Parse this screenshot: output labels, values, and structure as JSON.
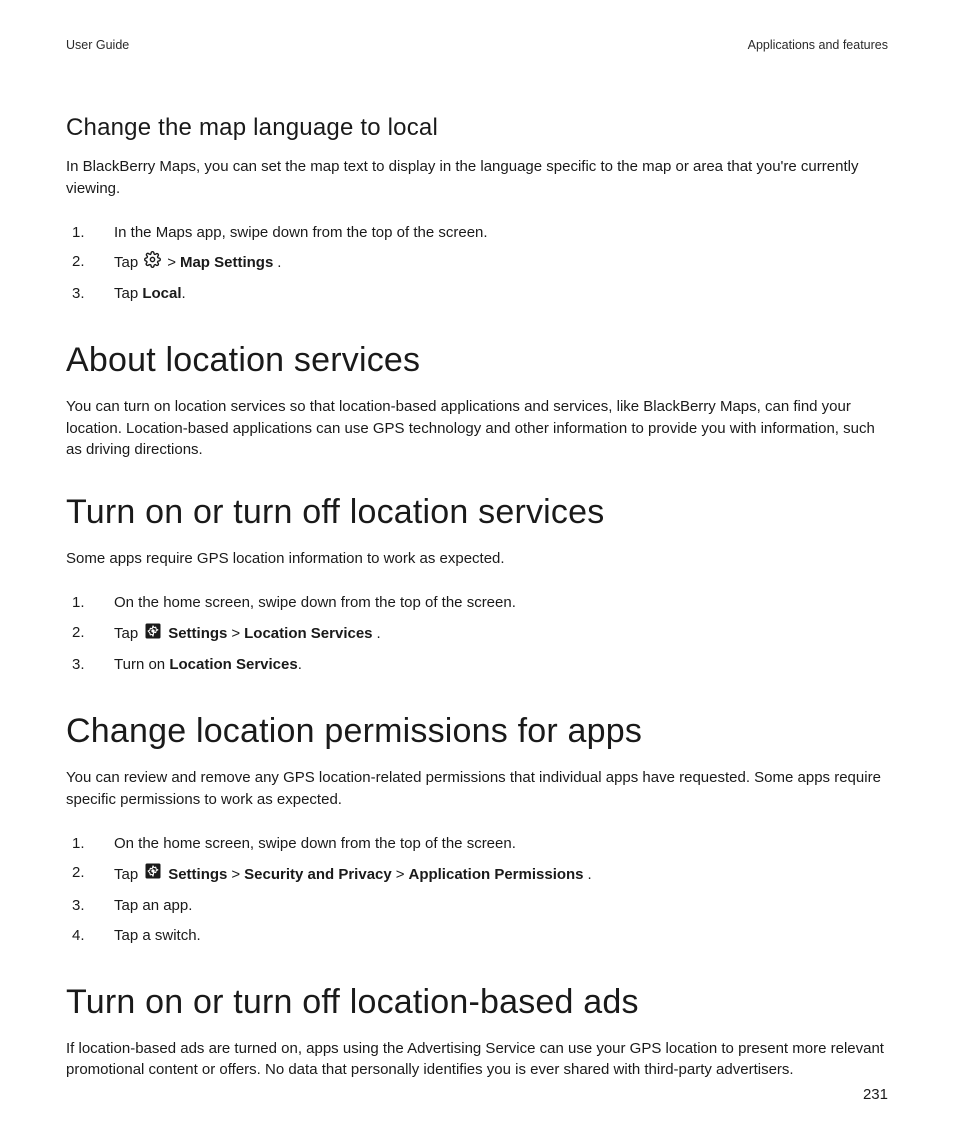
{
  "header": {
    "left": "User Guide",
    "right": "Applications and features"
  },
  "sections": {
    "changeMapLang": {
      "title": "Change the map language to local",
      "body": "In BlackBerry Maps, you can set the map text to display in the language specific to the map or area that you're currently viewing.",
      "steps": {
        "s1": "In the Maps app, swipe down from the top of the screen.",
        "s2_tap": "Tap",
        "s2_sep": " > ",
        "s2_bold": "Map Settings",
        "s2_end": ".",
        "s3_tap": "Tap ",
        "s3_bold": "Local",
        "s3_end": "."
      }
    },
    "aboutLocation": {
      "title": "About location services",
      "body": "You can turn on location services so that location-based applications and services, like BlackBerry Maps, can find your location. Location-based applications can use GPS technology and other information to provide you with information, such as driving directions."
    },
    "toggleLocation": {
      "title": "Turn on or turn off location services",
      "body": "Some apps require GPS location information to work as expected.",
      "steps": {
        "s1": "On the home screen, swipe down from the top of the screen.",
        "s2_tap": "Tap",
        "s2_settings": "Settings",
        "s2_sep": " > ",
        "s2_loc": "Location Services",
        "s2_end": ".",
        "s3_pre": "Turn on ",
        "s3_bold": "Location Services",
        "s3_end": "."
      }
    },
    "changePerms": {
      "title": "Change location permissions for apps",
      "body": "You can review and remove any GPS location-related permissions that individual apps have requested. Some apps require specific permissions to work as expected.",
      "steps": {
        "s1": "On the home screen, swipe down from the top of the screen.",
        "s2_tap": "Tap",
        "s2_settings": "Settings",
        "s2_sep1": " > ",
        "s2_sec": "Security and Privacy",
        "s2_sep2": " > ",
        "s2_appperm": "Application Permissions",
        "s2_end": ".",
        "s3": "Tap an app.",
        "s4": "Tap a switch."
      }
    },
    "toggleAds": {
      "title": "Turn on or turn off location-based ads",
      "body": "If location-based ads are turned on, apps using the Advertising Service can use your GPS location to present more relevant promotional content or offers. No data that personally identifies you is ever shared with third-party advertisers."
    }
  },
  "pageNumber": "231",
  "icons": {
    "gearOutline": "settings-icon",
    "gearSolid": "settings-icon"
  }
}
